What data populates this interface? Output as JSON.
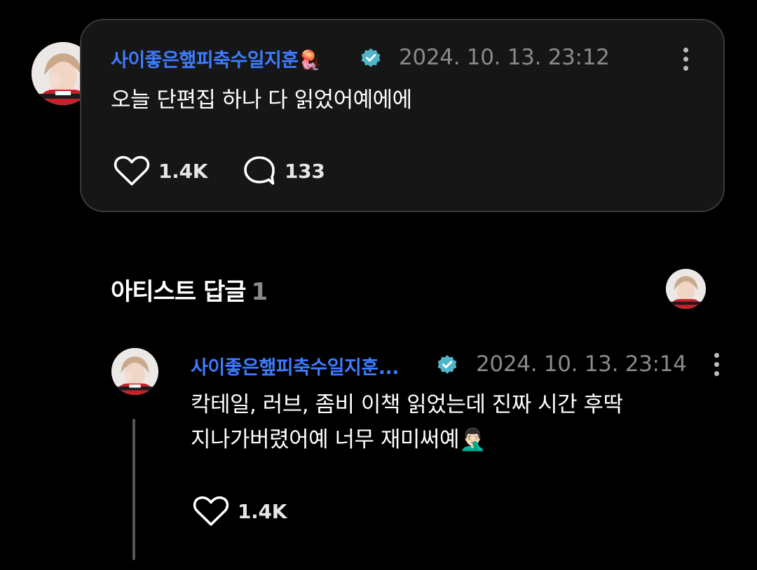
{
  "post": {
    "author": "사이좋은햎피축수일지훈🪼",
    "timestamp": "2024. 10. 13. 23:12",
    "body": "오늘 단편집 하나 다 읽었어예에에",
    "likes": "1.4K",
    "comments": "133"
  },
  "section": {
    "title": "아티스트 답글",
    "count": "1"
  },
  "reply": {
    "author": "사이좋은햎피축수일지훈...",
    "timestamp": "2024. 10. 13. 23:14",
    "body_line1": "칵테일, 러브, 좀비 이책 읽었는데 진짜 시간 후딱",
    "body_line2": "지나가버렸어예 너무 재미써예🤦🏻‍♂️",
    "likes": "1.4K"
  },
  "icons": {
    "verified": "verified-badge-icon",
    "more": "more-vertical-icon",
    "like": "heart-outline-icon",
    "comment": "speech-bubble-icon"
  },
  "colors": {
    "author_name": "#3d7bff",
    "verified_badge": "#4fb6c9",
    "timestamp": "#8a8a8a",
    "card_background": "#161616",
    "page_background": "#000000"
  }
}
